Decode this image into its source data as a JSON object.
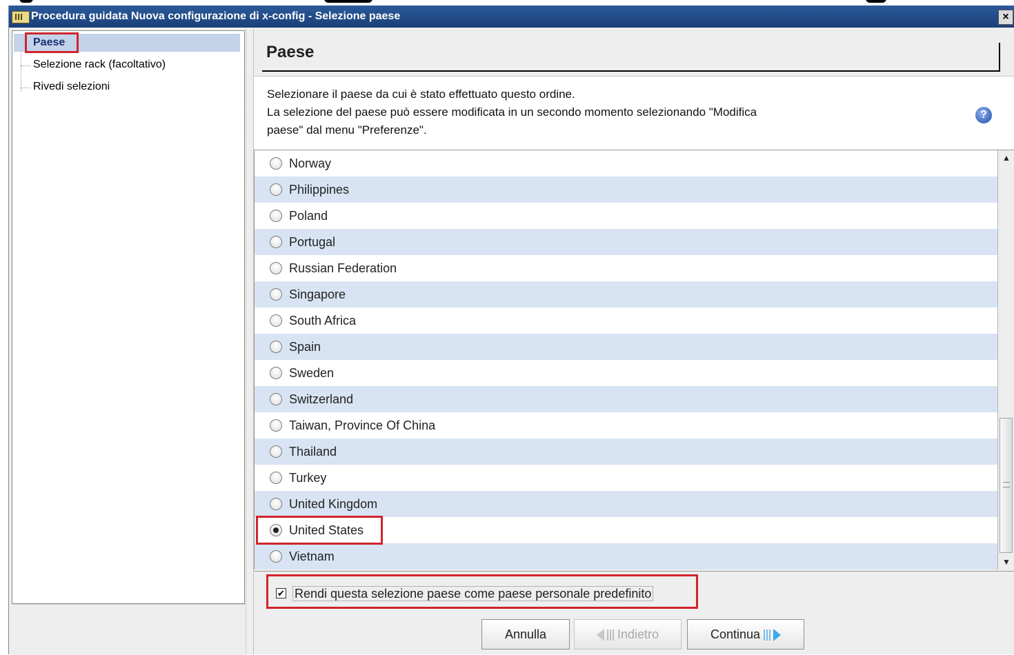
{
  "window": {
    "title": "Procedura guidata Nuova configurazione di x-config - Selezione paese",
    "close_label": "×"
  },
  "nav": {
    "items": [
      {
        "label": "Paese",
        "selected": true
      },
      {
        "label": "Selezione rack (facoltativo)",
        "selected": false
      },
      {
        "label": "Rivedi selezioni",
        "selected": false
      }
    ]
  },
  "main": {
    "heading": "Paese",
    "description": [
      "Selezionare il paese da cui è stato effettuato questo ordine.",
      "La selezione del paese può essere modificata in un secondo momento selezionando \"Modifica",
      "paese\" dal menu \"Preferenze\"."
    ],
    "help_icon": "question-mark-icon",
    "help_glyph": "?",
    "countries": [
      {
        "label": "Norway",
        "checked": false
      },
      {
        "label": "Philippines",
        "checked": false
      },
      {
        "label": "Poland",
        "checked": false
      },
      {
        "label": "Portugal",
        "checked": false
      },
      {
        "label": "Russian Federation",
        "checked": false
      },
      {
        "label": "Singapore",
        "checked": false
      },
      {
        "label": "South Africa",
        "checked": false
      },
      {
        "label": "Spain",
        "checked": false
      },
      {
        "label": "Sweden",
        "checked": false
      },
      {
        "label": "Switzerland",
        "checked": false
      },
      {
        "label": "Taiwan, Province Of China",
        "checked": false
      },
      {
        "label": "Thailand",
        "checked": false
      },
      {
        "label": "Turkey",
        "checked": false
      },
      {
        "label": "United Kingdom",
        "checked": false
      },
      {
        "label": "United States",
        "checked": true
      },
      {
        "label": "Vietnam",
        "checked": false
      }
    ],
    "default_checkbox": {
      "label": "Rendi questa selezione paese come paese personale predefinito",
      "checked": true,
      "glyph": "✔"
    }
  },
  "buttons": {
    "cancel": "Annulla",
    "back": "Indietro",
    "continue": "Continua"
  },
  "colors": {
    "titlebar": "#1f4a88",
    "highlight": "#d0242b",
    "row_alt": "#d8e4f3",
    "selected_nav": "#c3d3ea"
  }
}
